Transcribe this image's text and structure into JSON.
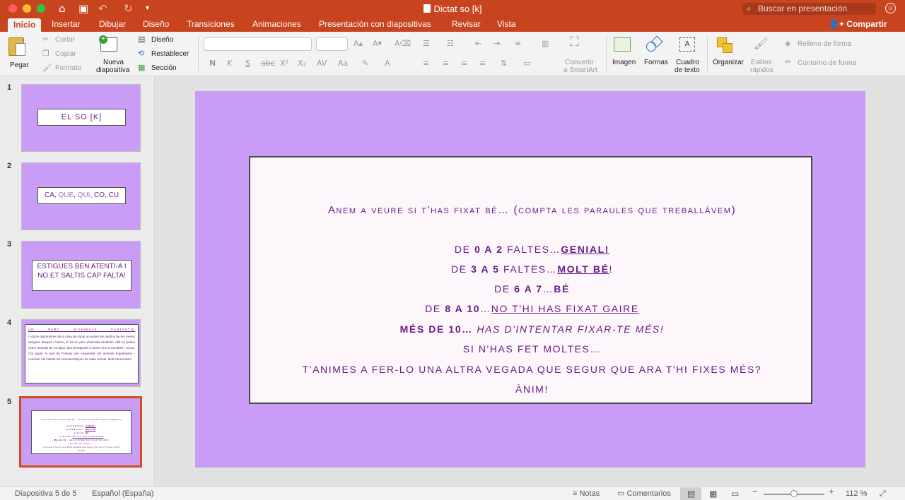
{
  "window": {
    "title": "Dictat so [k]",
    "search_placeholder": "Buscar en presentación"
  },
  "tabs": [
    "Inicio",
    "Insertar",
    "Dibujar",
    "Diseño",
    "Transiciones",
    "Animaciones",
    "Presentación con diapositivas",
    "Revisar",
    "Vista"
  ],
  "share_label": "Compartir",
  "ribbon": {
    "pegar": "Pegar",
    "cortar": "Cortar",
    "copiar": "Copiar",
    "formato": "Formato",
    "nueva_1": "Nueva",
    "nueva_2": "diapositiva",
    "diseno": "Diseño",
    "restablecer": "Restablecer",
    "seccion": "Sección",
    "convertir_1": "Convertir",
    "convertir_2": "a SmartArt",
    "imagen": "Imagen",
    "formas": "Formas",
    "cuadro_1": "Cuadro",
    "cuadro_2": "de texto",
    "organizar": "Organizar",
    "estilos_1": "Estilos",
    "estilos_2": "rápidos",
    "relleno": "Relleno de forma",
    "contorno": "Contorno de forma",
    "fmt_buttons": [
      "N",
      "K",
      "S",
      "abc",
      "X²",
      "X₂"
    ]
  },
  "thumbnails": {
    "numbers": [
      "1",
      "2",
      "3",
      "4",
      "5"
    ],
    "t1": "EL SO [K]",
    "t2": {
      "a": "CA, ",
      "b": "QUE",
      "c": ", ",
      "d": "QUI",
      "e": ", CO, CU"
    },
    "t3": "ESTIGUES BEN ATENT/-A I NO ET SALTIS CAP FALTA!",
    "t4_title": "UN PARC D'ANIMALS FANTÀSTIC",
    "t4_body": "A dotze quilòmetres de la casa de camp on visten els padrins de les meves amigues Raquel i Carme, hi ha un parc d'animals fantàstic. Allà es poden veure animals de tot tipus: des d'esquirols i coloms fins a cocodrils i cocos. Cal pagar el pas de l'estany per esquerdar els animals equatorians i conèixer els infants les característiques de cada animal. Molt interessant!"
  },
  "slide": {
    "line1": "Anem a veure si t'has fixat bé… (compta les paraules que treballàvem)",
    "l2a": "de ",
    "l2b": "0 a 2",
    "l2c": " faltes…",
    "l2d": "GENIAL!",
    "l3a": "de ",
    "l3b": "3 a 5",
    "l3c": " faltes…",
    "l3d": "MOLT BÉ",
    "l3e": "!",
    "l4a": "de ",
    "l4b": "6 a 7",
    "l4c": "…",
    "l4d": "BÉ",
    "l5a": "de ",
    "l5b": "8 a 10",
    "l5c": "…",
    "l5d": "NO T'HI HAS FIXAT GAIRE",
    "l6a": "Més de 10… ",
    "l6b": "HAS D'INTENTAR FIXAR-TE MÉS!",
    "line7": "Si n'has fet moltes…",
    "line8": "t'animes a fer-lo una altra vegada que segur que ara t'hi fixes més?",
    "line9": "ÀNIM!"
  },
  "status": {
    "slide_counter": "Diapositiva 5 de 5",
    "language": "Español (España)",
    "notes": "Notas",
    "comments": "Comentarios",
    "zoom": "112 %"
  }
}
